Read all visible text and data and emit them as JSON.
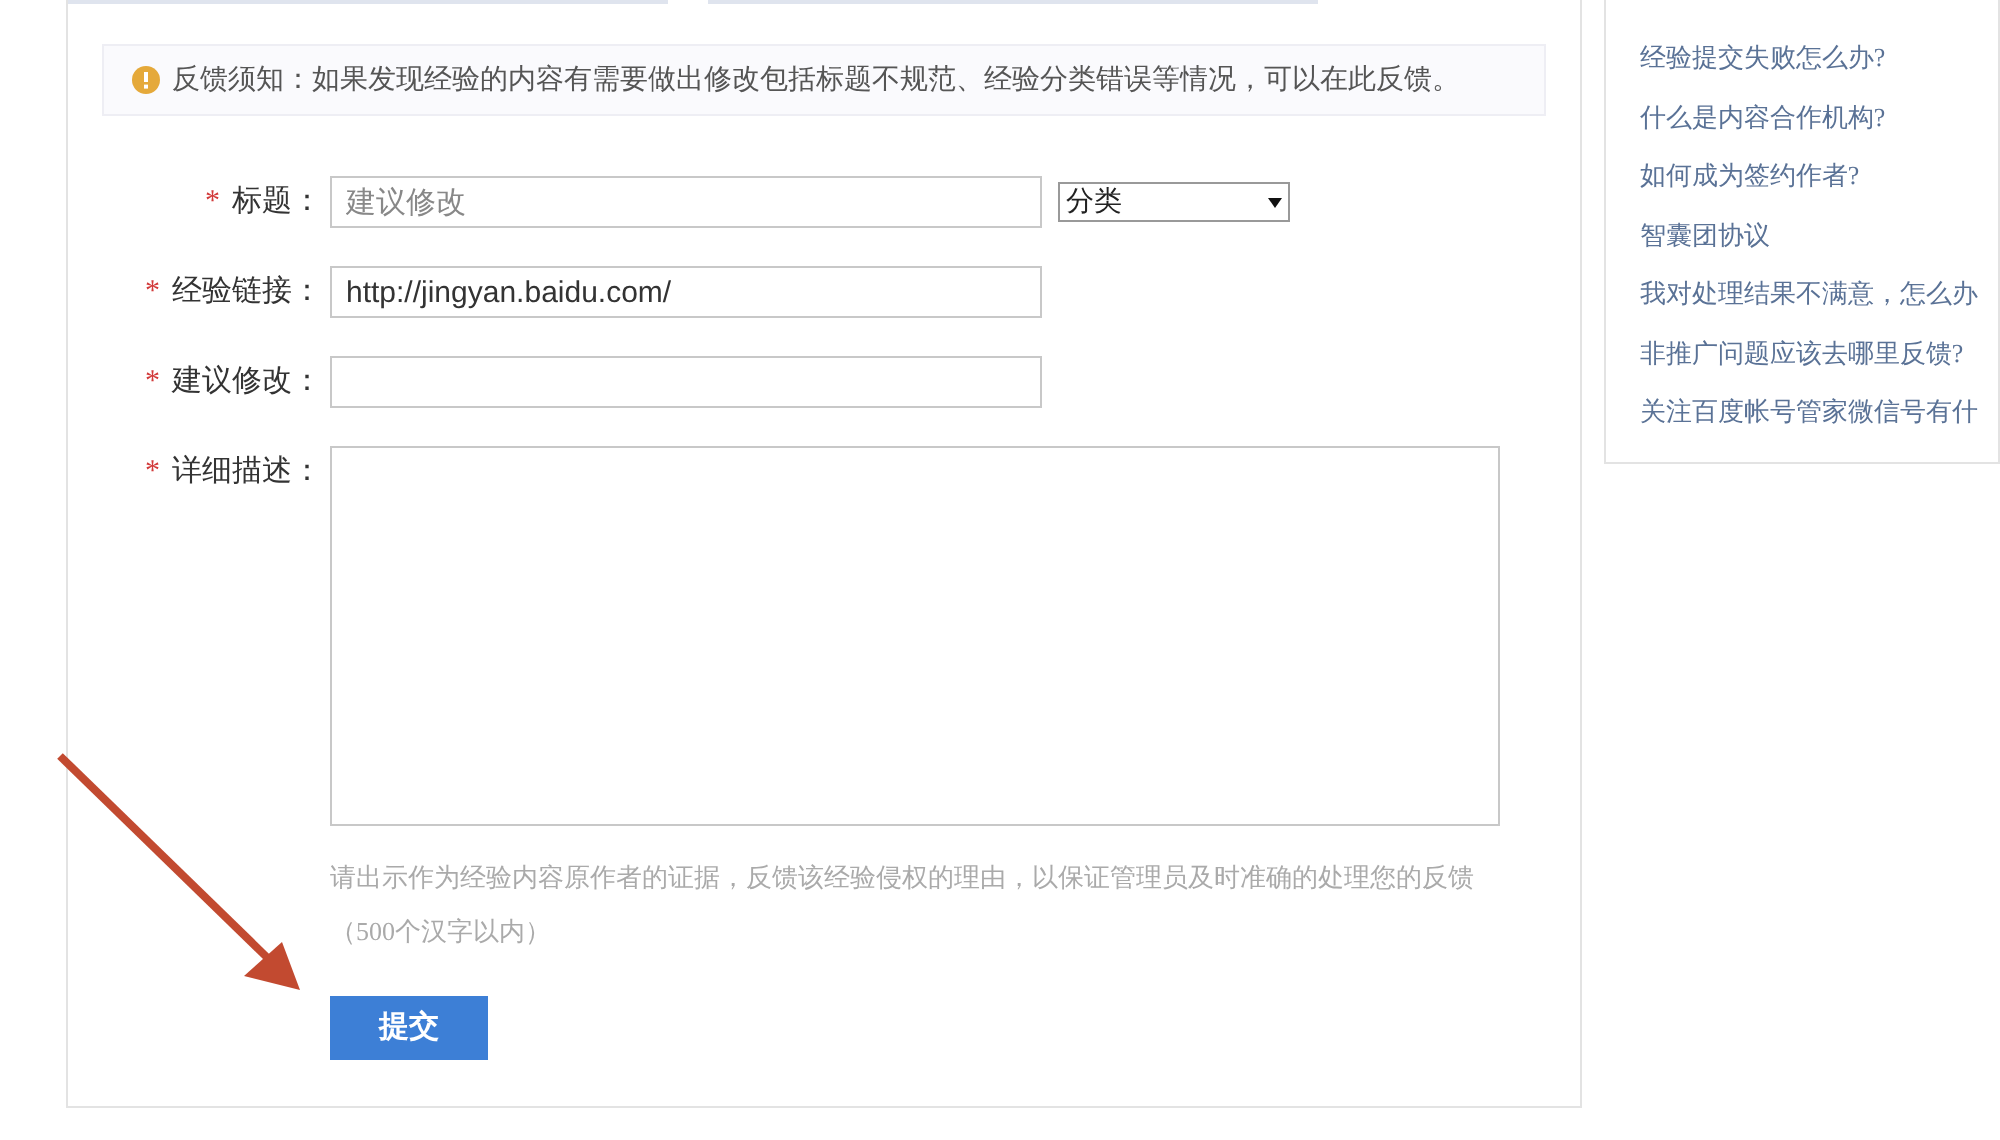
{
  "notice": {
    "text": "反馈须知：如果发现经验的内容有需要做出修改包括标题不规范、经验分类错误等情况，可以在此反馈。"
  },
  "form": {
    "fields": [
      {
        "kind": "text",
        "mark": "*",
        "label": "标题：",
        "placeholder": "建议修改",
        "select": "分类"
      },
      {
        "kind": "text",
        "mark": "*",
        "label": "经验链接：",
        "value": "http://jingyan.baidu.com/"
      },
      {
        "kind": "text",
        "mark": "*",
        "label": "建议修改："
      },
      {
        "kind": "textarea",
        "mark": "*",
        "label": "详细描述："
      }
    ],
    "hint": "请出示作为经验内容原作者的证据，反馈该经验侵权的理由，以保证管理员及时准确的处理您的反馈",
    "hint_limit": "（500个汉字以内）",
    "submit": "提交"
  },
  "sidebar": {
    "links": [
      "经验提交失败怎么办?",
      "什么是内容合作机构?",
      "如何成为签约作者?",
      "智囊团协议",
      "我对处理结果不满意，怎么办",
      "非推广问题应该去哪里反馈?",
      "关注百度帐号管家微信号有什"
    ]
  }
}
